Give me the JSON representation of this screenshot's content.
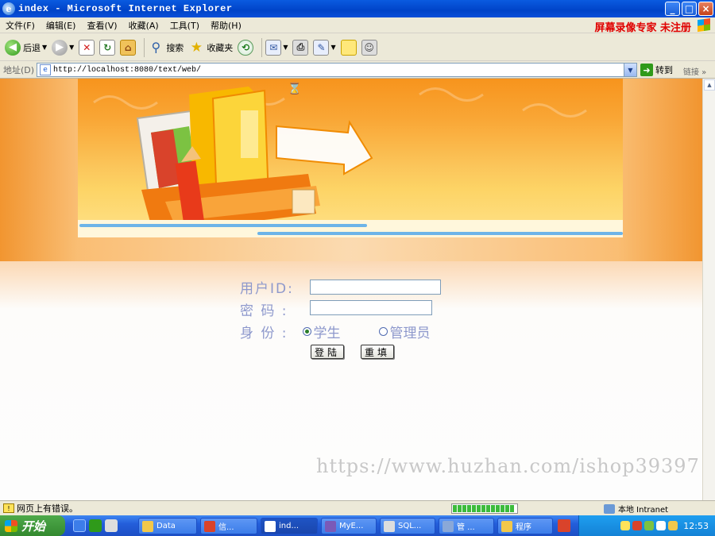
{
  "window": {
    "title": "index - Microsoft Internet Explorer",
    "buttons": [
      "_",
      "□",
      "×"
    ]
  },
  "menu": {
    "items": [
      "文件(F)",
      "编辑(E)",
      "查看(V)",
      "收藏(A)",
      "工具(T)",
      "帮助(H)"
    ],
    "brand": "屏幕录像专家 未注册"
  },
  "toolbar": {
    "back_label": "后退",
    "search_label": "搜索",
    "favorites_label": "收藏夹"
  },
  "address": {
    "label": "地址(D)",
    "url": "http://localhost:8080/text/web/",
    "go_label": "转到",
    "links_label": "链接 »"
  },
  "login": {
    "userid_label": "用户ID:",
    "password_label": "密 码 :",
    "identity_label": "身 份 :",
    "userid_value": "",
    "password_value": "",
    "role_student": "学生",
    "role_admin": "管理员",
    "selected_role": "学生",
    "login_button": "登陆",
    "reset_button": "重填"
  },
  "watermark": "https://www.huzhan.com/ishop39397",
  "status": {
    "text": "网页上有错误。",
    "zone": "本地 Intranet"
  },
  "taskbar": {
    "start_label": "开始",
    "tasks": [
      "Data",
      "信...",
      "ind...",
      "MyE...",
      "SQL...",
      "管 ...",
      "程序"
    ],
    "time": "12:53"
  }
}
